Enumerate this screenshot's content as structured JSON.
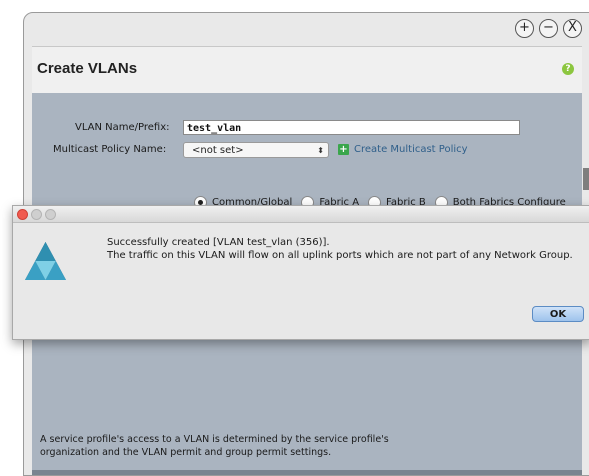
{
  "window": {
    "controls": {
      "maximize": "+",
      "minimize": "−",
      "close": "X"
    }
  },
  "dialog": {
    "title": "Create VLANs",
    "help_icon": "?",
    "vlan_name_label": "VLAN Name/Prefix:",
    "vlan_name_value": "test_vlan",
    "multicast_label": "Multicast Policy Name:",
    "multicast_value": "<not set>",
    "create_multicast_link": "Create Multicast Policy",
    "radio_options": [
      {
        "label": "Common/Global",
        "selected": true
      },
      {
        "label": "Fabric A",
        "selected": false
      },
      {
        "label": "Fabric B",
        "selected": false
      },
      {
        "label": "Both Fabrics Configure",
        "selected": false
      }
    ],
    "service_profile_note_line1": "A service profile's access to a VLAN is determined by the service profile's",
    "service_profile_note_line2": "organization and the VLAN permit and group permit settings."
  },
  "alert": {
    "message_line1": "Successfully created [VLAN test_vlan (356)].",
    "message_line2": "The traffic on this VLAN will flow on all uplink ports which are not part of any Network Group.",
    "ok_label": "OK"
  },
  "colors": {
    "panel_bg": "#aab4c0",
    "link": "#2f5f8a",
    "accent_green": "#3aa64c",
    "close_red": "#f05a4f",
    "ok_blue": "#9ec3ec"
  }
}
